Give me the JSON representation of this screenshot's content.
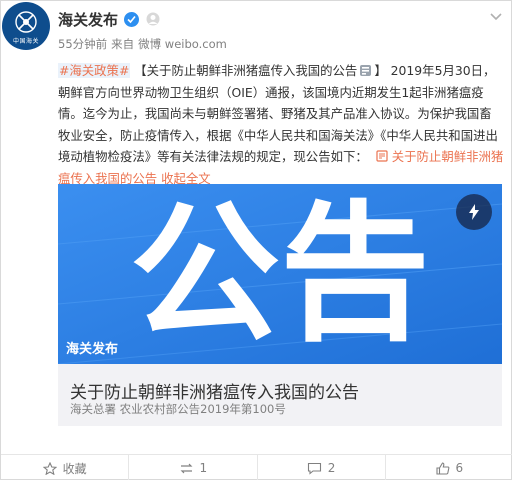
{
  "author": {
    "name": "海关发布",
    "avatar_text": "中国海关"
  },
  "meta": {
    "time": "55分钟前",
    "source_prefix": "来自",
    "source": "微博 weibo.com"
  },
  "post": {
    "tag": "#海关政策#",
    "text_main": "【关于防止朝鲜非洲猪瘟传入我国的公告",
    "text_main_end": "】 2019年5月30日，朝鲜官方向世界动物卫生组织（OIE）通报，该国境内近期发生1起非洲猪瘟疫情。迄今为止，我国尚未与朝鲜签署猪、野猪及其产品准入协议。为保护我国畜牧业安全，防止疫情传入，根据《中华人民共和国海关法》《中华人民共和国进出境动植物检疫法》等有关法律法规的规定，现公告如下：",
    "link_text": "关于防止朝鲜非洲猪瘟传入我国的公告",
    "collapse": "收起全文"
  },
  "card": {
    "badge": "海关发布",
    "image_word": "公告",
    "title": "关于防止朝鲜非洲猪瘟传入我国的公告",
    "subtitle": "海关总署 农业农村部公告2019年第100号"
  },
  "actions": {
    "favorite": "收藏",
    "repost": "1",
    "comment": "2",
    "like": "6"
  },
  "colors": {
    "accent": "#eb7350",
    "card_blue": "#2b7ee6"
  }
}
